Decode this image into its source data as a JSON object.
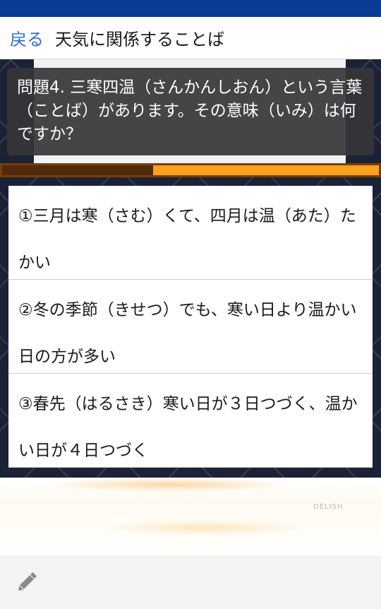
{
  "nav": {
    "back_label": "戻る",
    "title": "天気に関係することば"
  },
  "question": {
    "text": "問題4. 三寒四温（さんかんしおん）という言葉（ことば）があります。その意味（いみ）は何ですか？"
  },
  "progress": {
    "fraction": 0.4
  },
  "answers": [
    {
      "text": "①三月は寒（さむ）くて、四月は温（あた）たかい"
    },
    {
      "text": "②冬の季節（きせつ）でも、寒い日より温かい日の方が多い"
    },
    {
      "text": "③春先（はるさき）寒い日が３日つづく、温かい日が４日つづく"
    }
  ],
  "ad": {
    "watermark": "DELISH"
  },
  "toolbar": {
    "edit_icon": "pencil-icon"
  },
  "colors": {
    "status_bar": "#0b3a93",
    "link": "#2a6fcf",
    "progress_fill": "#4f2a0d",
    "progress_track": "#f8a11e"
  }
}
